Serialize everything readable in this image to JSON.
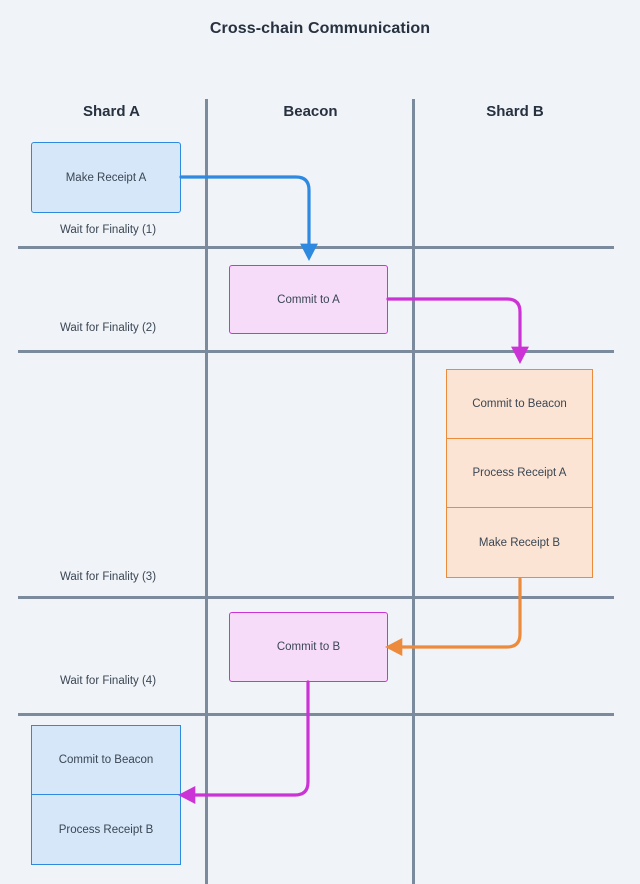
{
  "title": "Cross-chain Communication",
  "columns": [
    {
      "label": "Shard A"
    },
    {
      "label": "Beacon"
    },
    {
      "label": "Shard B"
    }
  ],
  "wait_labels": [
    {
      "label": "Wait for Finality (1)"
    },
    {
      "label": "Wait for Finality (2)"
    },
    {
      "label": "Wait for Finality (3)"
    },
    {
      "label": "Wait for Finality (4)"
    }
  ],
  "nodes": {
    "make_receipt_a": "Make Receipt A",
    "commit_to_a": "Commit to A",
    "shard_b_group": [
      "Commit to Beacon",
      "Process Receipt A",
      "Make Receipt B"
    ],
    "commit_to_b": "Commit to B",
    "shard_a_group": [
      "Commit to Beacon",
      "Process Receipt B"
    ]
  },
  "colors": {
    "background": "#f0f3f7",
    "title_text": "#27313f",
    "grid_line": "#7b8a9c",
    "blue_fill": "#d6e7f9",
    "blue_stroke": "#2e8ae0",
    "purple_fill": "#f6dcf9",
    "purple_stroke": "#cc33d6",
    "orange_fill": "#fbe4d3",
    "orange_stroke": "#ed8b3c"
  },
  "edges": [
    {
      "name": "make-receipt-a-to-commit-to-a",
      "color": "#2e8ae0"
    },
    {
      "name": "commit-to-a-to-shard-b",
      "color": "#cc33d6"
    },
    {
      "name": "make-receipt-b-to-commit-to-b",
      "color": "#ed8b3c"
    },
    {
      "name": "commit-to-b-to-shard-a",
      "color": "#cc33d6"
    }
  ]
}
